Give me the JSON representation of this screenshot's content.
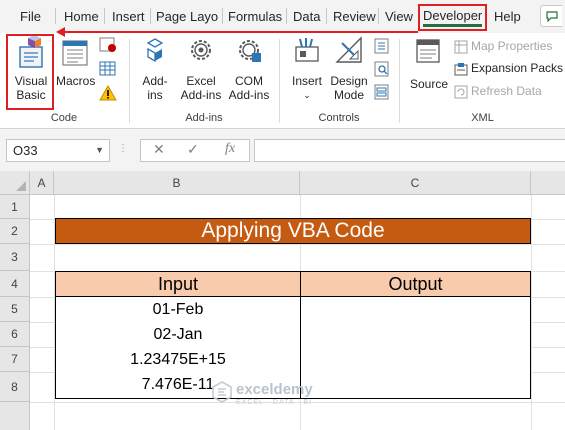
{
  "tabs": [
    "File",
    "Home",
    "Insert",
    "Page Layo",
    "Formulas",
    "Data",
    "Review",
    "View",
    "Developer",
    "Help"
  ],
  "ribbon": {
    "code": {
      "label": "Code",
      "visual_basic": [
        "Visual",
        "Basic"
      ],
      "macros": "Macros"
    },
    "addins": {
      "label": "Add-ins",
      "addins_btn": [
        "Add-",
        "ins"
      ],
      "excel_addins": [
        "Excel",
        "Add-ins"
      ],
      "com_addins": [
        "COM",
        "Add-ins"
      ]
    },
    "controls": {
      "label": "Controls",
      "insert": "Insert",
      "design_mode": [
        "Design",
        "Mode"
      ]
    },
    "xml": {
      "label": "XML",
      "source": "Source",
      "map_properties": "Map Properties",
      "expansion_packs": "Expansion Packs",
      "refresh_data": "Refresh Data"
    }
  },
  "formula_bar": {
    "name_box": "O33",
    "fx": "fx",
    "formula": ""
  },
  "sheet": {
    "columns": [
      "A",
      "B",
      "C"
    ],
    "rows": [
      "1",
      "2",
      "3",
      "4",
      "5",
      "6",
      "7",
      "8"
    ],
    "title": "Applying VBA Code",
    "headers": [
      "Input",
      "Output"
    ],
    "data_rows": [
      {
        "input": "01-Feb",
        "output": ""
      },
      {
        "input": "02-Jan",
        "output": ""
      },
      {
        "input": "1.23475E+15",
        "output": ""
      },
      {
        "input": "7.476E-11",
        "output": ""
      }
    ]
  },
  "watermark": {
    "name": "exceldemy",
    "sub": "EXCEL · DATA · BI"
  },
  "colors": {
    "title_fill": "#c55a11",
    "header_fill": "#f8cbad",
    "highlight": "#e02020",
    "accent": "#1e7145"
  }
}
